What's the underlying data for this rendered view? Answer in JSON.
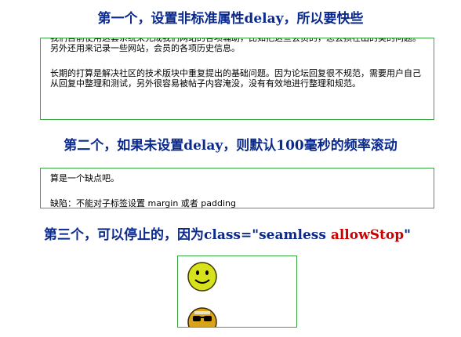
{
  "headings": {
    "first": "第一个，设置非标准属性delay，所以要快些",
    "second": "第二个，如果未设置delay，则默认100毫秒的频率滚动",
    "third_prefix": "第三个，可以停止的，因为class=\"seamless ",
    "third_highlight": "allowStop",
    "third_suffix": "\""
  },
  "marquee1": {
    "paragraphs": [
      "我们目前使用这套系统来完成我们网站的各项辅助，比如把这些会员的，总会损在出的类的问题。另外还用来记录一些网站，会员的各项历史信息。",
      "长期的打算是解决社区的技术版块中重复提出的基础问题。因为论坛回复很不规范，需要用户自己从回复中整理和测试，另外很容易被帖子内容淹没，没有有效地进行整理和规范。"
    ]
  },
  "marquee2": {
    "paragraphs": [
      "算是一个缺点吧。",
      "缺陷：不能对子标签设置 margin 或者 padding"
    ]
  },
  "marquee3": {
    "items": [
      "smiley-face",
      "sunglasses-face"
    ]
  },
  "colors": {
    "heading": "#0b2a8c",
    "highlight": "#cc0000",
    "border": "#3aa843",
    "smiley_yellow": "#d8e21c"
  }
}
